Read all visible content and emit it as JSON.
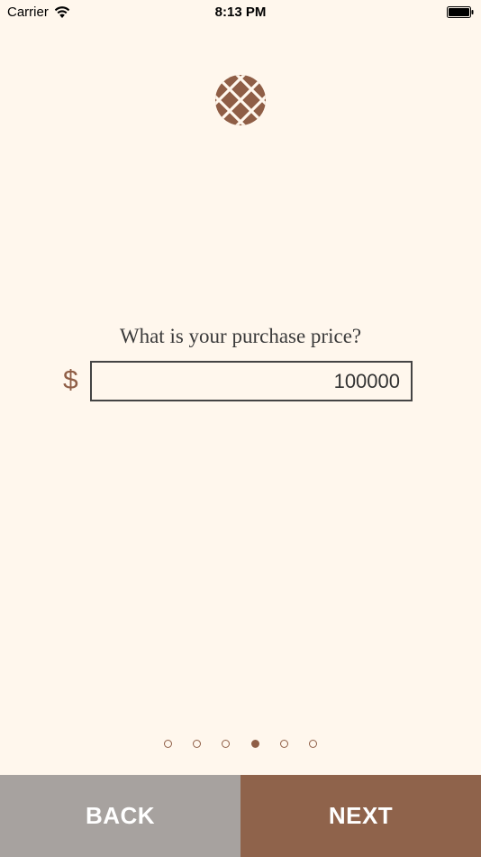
{
  "status_bar": {
    "carrier": "Carrier",
    "time": "8:13 PM"
  },
  "question": {
    "label": "What is your purchase price?",
    "currency_symbol": "$",
    "value": "100000"
  },
  "pager": {
    "count": 6,
    "active_index": 3
  },
  "buttons": {
    "back_label": "BACK",
    "next_label": "NEXT"
  },
  "colors": {
    "background": "#fff7ed",
    "accent": "#8f634b",
    "back": "#a7a29f"
  }
}
